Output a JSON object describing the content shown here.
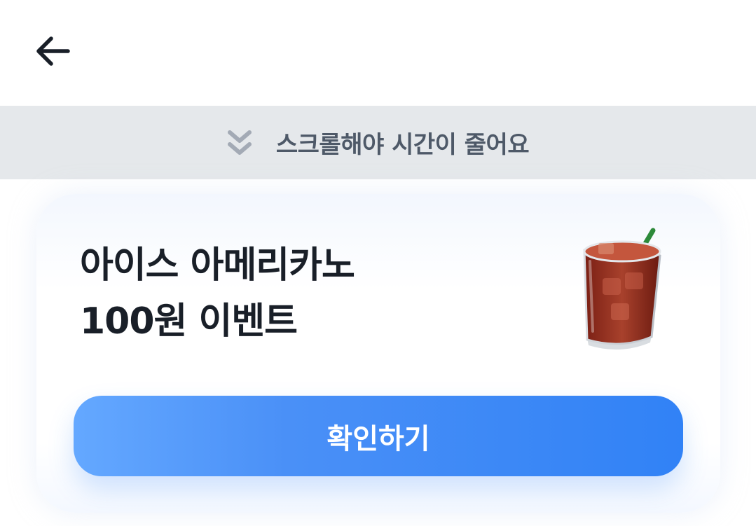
{
  "header": {
    "back_icon": "arrow-left-icon"
  },
  "banner": {
    "icon": "double-chevron-down-icon",
    "text": "스크롤해야 시간이 줄어요"
  },
  "card": {
    "title_line1": "아이스 아메리카노",
    "title_line2": "100원 이벤트",
    "image": "iced-americano-icon",
    "button_label": "확인하기"
  },
  "colors": {
    "banner_bg": "#e5e8eb",
    "banner_text": "#4e5968",
    "title_text": "#191f28",
    "button_blue": "#3182f6"
  }
}
